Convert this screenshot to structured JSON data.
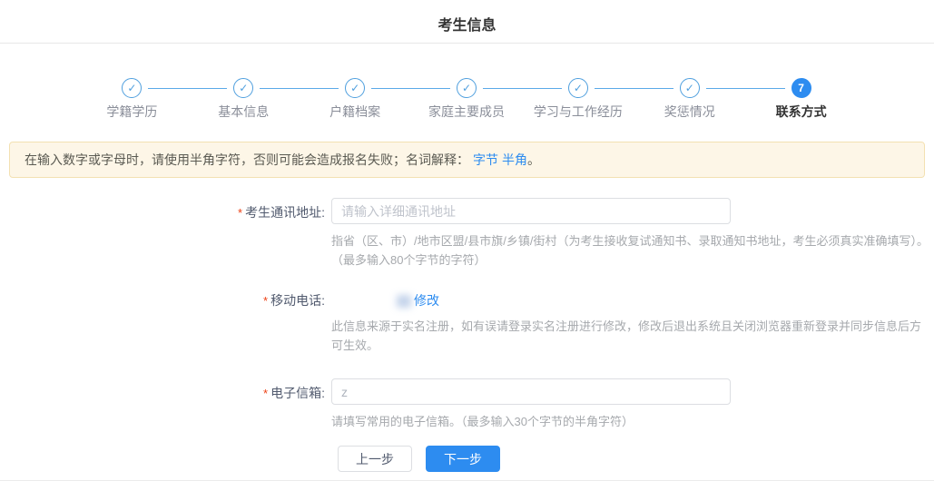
{
  "page": {
    "title": "考生信息"
  },
  "stepper": {
    "steps": [
      {
        "label": "学籍学历",
        "state": "done"
      },
      {
        "label": "基本信息",
        "state": "done"
      },
      {
        "label": "户籍档案",
        "state": "done"
      },
      {
        "label": "家庭主要成员",
        "state": "done"
      },
      {
        "label": "学习与工作经历",
        "state": "done"
      },
      {
        "label": "奖惩情况",
        "state": "done"
      },
      {
        "label": "联系方式",
        "state": "active",
        "number": "7"
      }
    ]
  },
  "alert": {
    "text": "在输入数字或字母时，请使用半角字符，否则可能会造成报名失败；名词解释：",
    "link_byte": "字节",
    "link_halfwidth": "半角",
    "suffix": "。"
  },
  "form": {
    "address": {
      "required_mark": "*",
      "label": "考生通讯地址:",
      "placeholder": "请输入详细通讯地址",
      "help_line1": "指省（区、市）/地市区盟/县市旗/乡镇/街村（为考生接收复试通知书、录取通知书地址，考生必须真实准确填写）。",
      "help_line2": "（最多输入80个字节的字符）"
    },
    "mobile": {
      "required_mark": "*",
      "label": "移动电话:",
      "modify_link": "修改",
      "note": "此信息来源于实名注册，如有误请登录实名注册进行修改，修改后退出系统且关闭浏览器重新登录并同步信息后方可生效。"
    },
    "email": {
      "required_mark": "*",
      "label": "电子信箱:",
      "value": "z",
      "help": "请填写常用的电子信箱。（最多输入30个字节的半角字符）"
    }
  },
  "buttons": {
    "prev": "上一步",
    "next": "下一步"
  },
  "colors": {
    "primary": "#2d8cf0",
    "alert_bg": "#fdf6e7",
    "alert_border": "#f3e1b2",
    "required": "#ed4014",
    "done_step": "#4f9fde"
  }
}
